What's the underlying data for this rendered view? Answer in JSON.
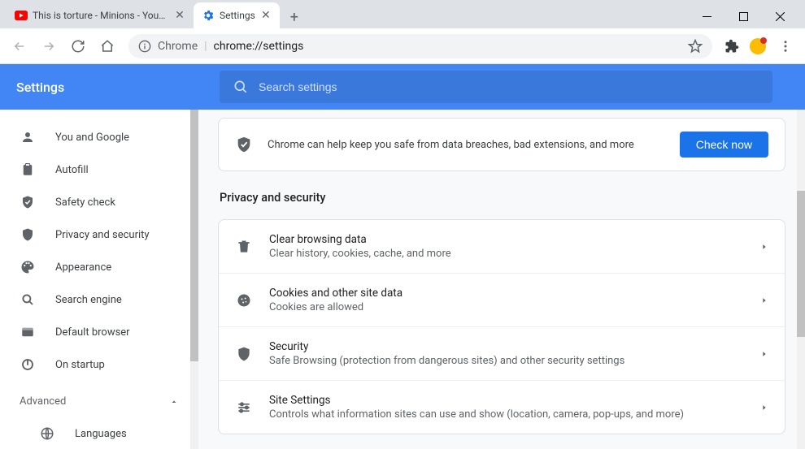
{
  "tabs": [
    {
      "title": "This is torture - Minions - YouTu",
      "icon": "youtube"
    },
    {
      "title": "Settings",
      "icon": "gear-blue"
    }
  ],
  "omnibox": {
    "prefix": "Chrome",
    "url": "chrome://settings"
  },
  "header": {
    "title": "Settings",
    "search_placeholder": "Search settings"
  },
  "sidebar": {
    "items": [
      {
        "label": "You and Google"
      },
      {
        "label": "Autofill"
      },
      {
        "label": "Safety check"
      },
      {
        "label": "Privacy and security"
      },
      {
        "label": "Appearance"
      },
      {
        "label": "Search engine"
      },
      {
        "label": "Default browser"
      },
      {
        "label": "On startup"
      }
    ],
    "advanced_label": "Advanced",
    "sub_items": [
      {
        "label": "Languages"
      }
    ]
  },
  "safety_banner": {
    "text": "Chrome can help keep you safe from data breaches, bad extensions, and more",
    "button": "Check now"
  },
  "section_title": "Privacy and security",
  "rows": [
    {
      "title": "Clear browsing data",
      "subtitle": "Clear history, cookies, cache, and more"
    },
    {
      "title": "Cookies and other site data",
      "subtitle": "Cookies are allowed"
    },
    {
      "title": "Security",
      "subtitle": "Safe Browsing (protection from dangerous sites) and other security settings"
    },
    {
      "title": "Site Settings",
      "subtitle": "Controls what information sites can use and show (location, camera, pop-ups, and more)"
    }
  ]
}
